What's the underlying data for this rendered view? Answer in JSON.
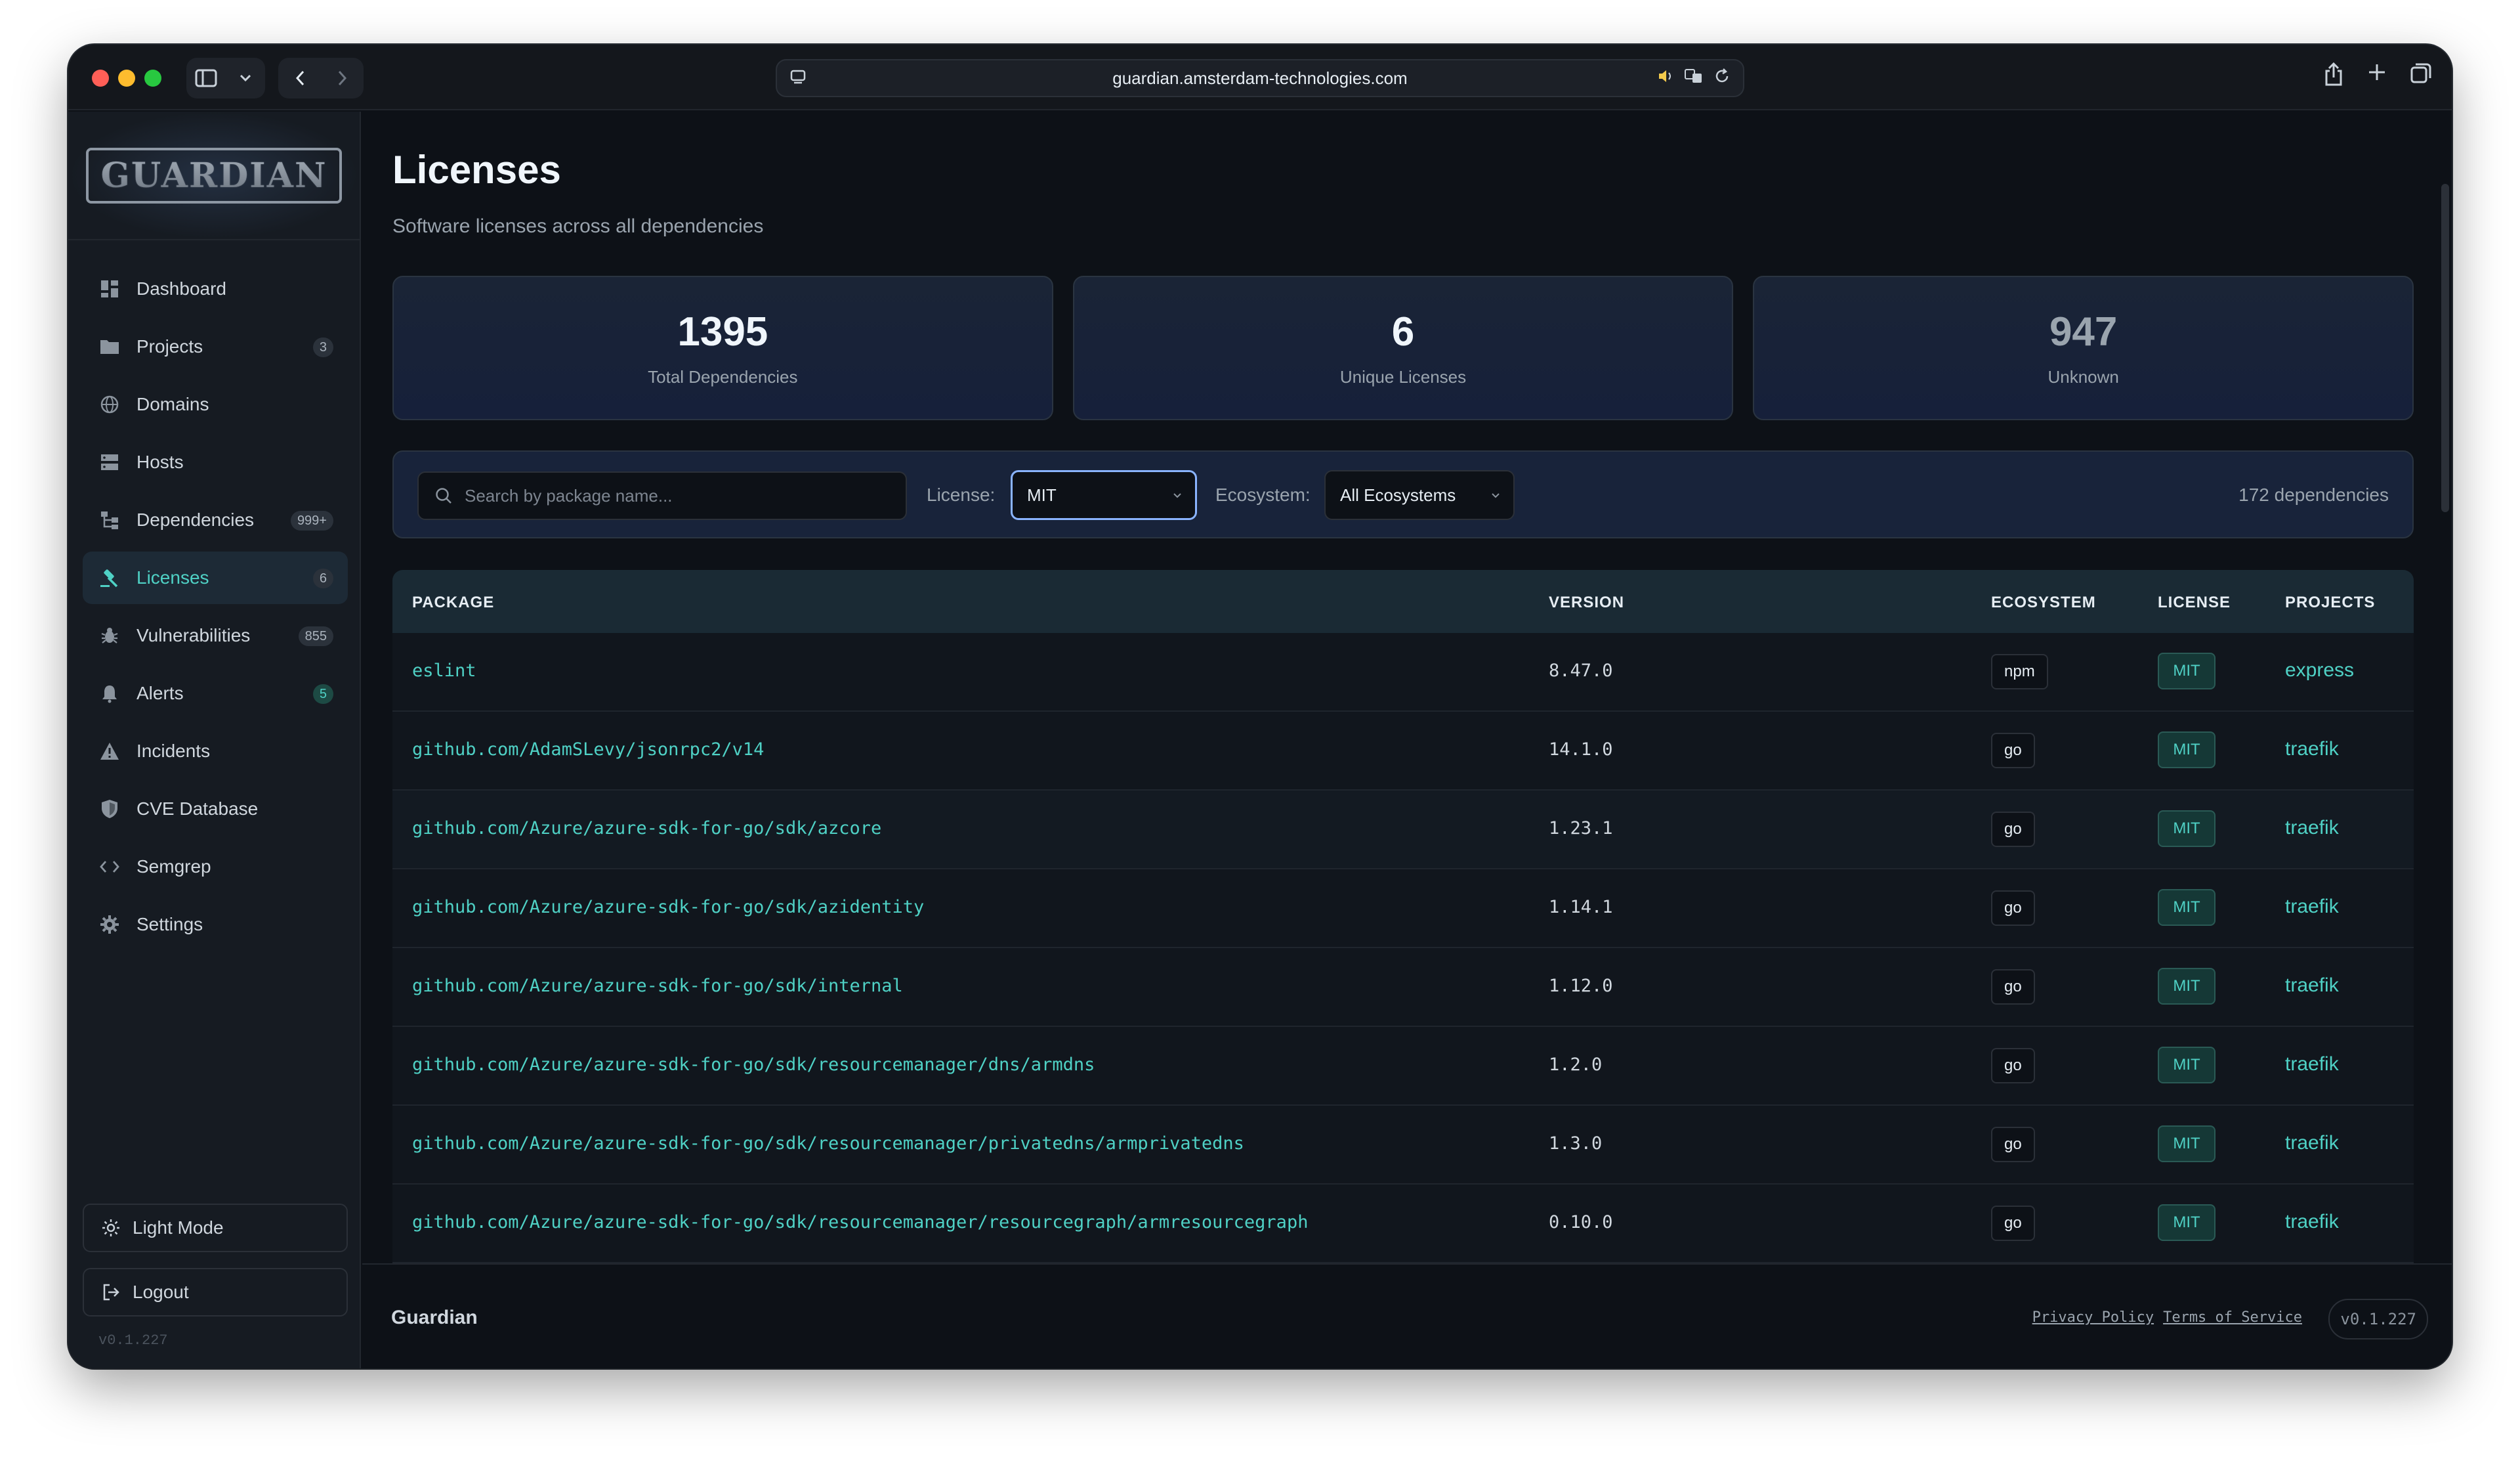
{
  "browser": {
    "url": "guardian.amsterdam-technologies.com"
  },
  "app": {
    "logo_text": "GUARDIAN"
  },
  "sidebar": {
    "items": [
      {
        "label": "Dashboard",
        "icon": "grid-icon",
        "badge": ""
      },
      {
        "label": "Projects",
        "icon": "folder-icon",
        "badge": "3"
      },
      {
        "label": "Domains",
        "icon": "globe-icon",
        "badge": ""
      },
      {
        "label": "Hosts",
        "icon": "server-icon",
        "badge": ""
      },
      {
        "label": "Dependencies",
        "icon": "tree-icon",
        "badge": "999+"
      },
      {
        "label": "Licenses",
        "icon": "gavel-icon",
        "badge": "6",
        "active": true
      },
      {
        "label": "Vulnerabilities",
        "icon": "bug-icon",
        "badge": "855"
      },
      {
        "label": "Alerts",
        "icon": "bell-icon",
        "badge": "5"
      },
      {
        "label": "Incidents",
        "icon": "warning-icon",
        "badge": ""
      },
      {
        "label": "CVE Database",
        "icon": "shield-icon",
        "badge": ""
      },
      {
        "label": "Semgrep",
        "icon": "code-icon",
        "badge": ""
      },
      {
        "label": "Settings",
        "icon": "gear-icon",
        "badge": ""
      }
    ],
    "light_mode_label": "Light Mode",
    "logout_label": "Logout",
    "version": "v0.1.227"
  },
  "page": {
    "title": "Licenses",
    "subtitle": "Software licenses across all dependencies"
  },
  "stats": [
    {
      "value": "1395",
      "label": "Total Dependencies"
    },
    {
      "value": "6",
      "label": "Unique Licenses"
    },
    {
      "value": "947",
      "label": "Unknown"
    }
  ],
  "filters": {
    "search_placeholder": "Search by package name...",
    "license_label": "License:",
    "license_value": "MIT",
    "ecosystem_label": "Ecosystem:",
    "ecosystem_value": "All Ecosystems",
    "count_text": "172 dependencies"
  },
  "table": {
    "headers": {
      "package": "PACKAGE",
      "version": "VERSION",
      "ecosystem": "ECOSYSTEM",
      "license": "LICENSE",
      "projects": "PROJECTS"
    },
    "rows": [
      {
        "package": "eslint",
        "version": "8.47.0",
        "ecosystem": "npm",
        "license": "MIT",
        "project": "express"
      },
      {
        "package": "github.com/AdamSLevy/jsonrpc2/v14",
        "version": "14.1.0",
        "ecosystem": "go",
        "license": "MIT",
        "project": "traefik"
      },
      {
        "package": "github.com/Azure/azure-sdk-for-go/sdk/azcore",
        "version": "1.23.1",
        "ecosystem": "go",
        "license": "MIT",
        "project": "traefik"
      },
      {
        "package": "github.com/Azure/azure-sdk-for-go/sdk/azidentity",
        "version": "1.14.1",
        "ecosystem": "go",
        "license": "MIT",
        "project": "traefik"
      },
      {
        "package": "github.com/Azure/azure-sdk-for-go/sdk/internal",
        "version": "1.12.0",
        "ecosystem": "go",
        "license": "MIT",
        "project": "traefik"
      },
      {
        "package": "github.com/Azure/azure-sdk-for-go/sdk/resourcemanager/dns/armdns",
        "version": "1.2.0",
        "ecosystem": "go",
        "license": "MIT",
        "project": "traefik"
      },
      {
        "package": "github.com/Azure/azure-sdk-for-go/sdk/resourcemanager/privatedns/armprivatedns",
        "version": "1.3.0",
        "ecosystem": "go",
        "license": "MIT",
        "project": "traefik"
      },
      {
        "package": "github.com/Azure/azure-sdk-for-go/sdk/resourcemanager/resourcegraph/armresourcegraph",
        "version": "0.10.0",
        "ecosystem": "go",
        "license": "MIT",
        "project": "traefik"
      }
    ]
  },
  "footer": {
    "brand": "Guardian",
    "privacy": "Privacy Policy",
    "terms": "Terms of Service",
    "version": "v0.1.227"
  }
}
